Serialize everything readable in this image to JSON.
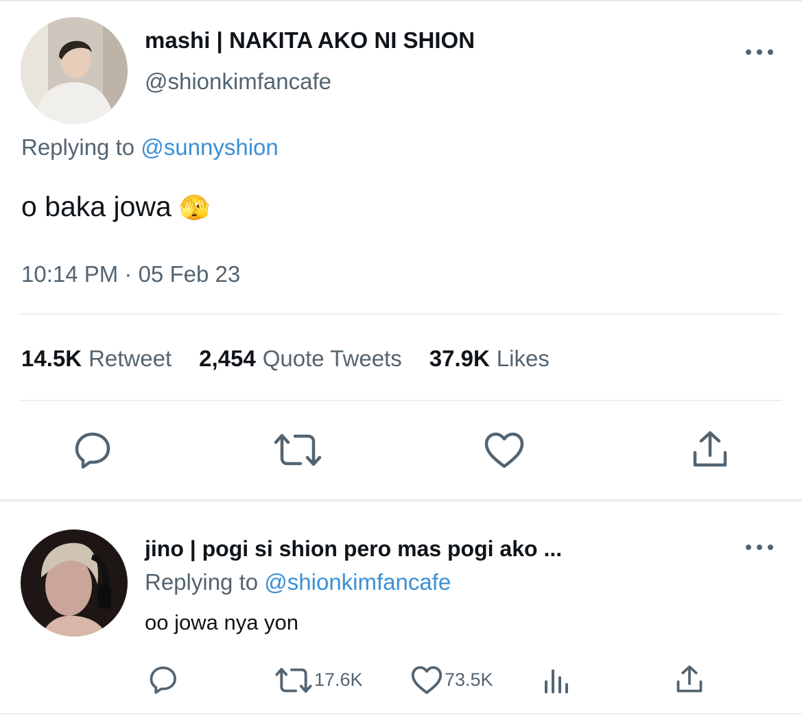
{
  "main_tweet": {
    "author_name": "mashi | NAKITA AKO NI SHION",
    "author_handle": "@shionkimfancafe",
    "replying_label": "Replying to",
    "replying_to": "@sunnyshion",
    "text": "o baka jowa",
    "emoji": "🫣",
    "timestamp": "10:14 PM · 05 Feb 23",
    "stats": {
      "retweets_count": "14.5K",
      "retweets_label": "Retweet",
      "quotes_count": "2,454",
      "quotes_label": "Quote Tweets",
      "likes_count": "37.9K",
      "likes_label": "Likes"
    },
    "actions": [
      "reply-icon",
      "retweet-icon",
      "like-icon",
      "share-icon"
    ]
  },
  "reply_tweet": {
    "author_name": "jino | pogi si shion pero mas pogi ako ...",
    "replying_label": "Replying to",
    "replying_to": "@shionkimfancafe",
    "text": "oo jowa nya yon",
    "retweet_count": "17.6K",
    "like_count": "73.5K",
    "actions": [
      "reply-icon",
      "retweet-icon",
      "like-icon",
      "analytics-icon",
      "share-icon"
    ]
  },
  "colors": {
    "text_primary": "#0f1419",
    "text_secondary": "#536471",
    "link": "#3a8fd6",
    "divider": "#eceef0"
  }
}
